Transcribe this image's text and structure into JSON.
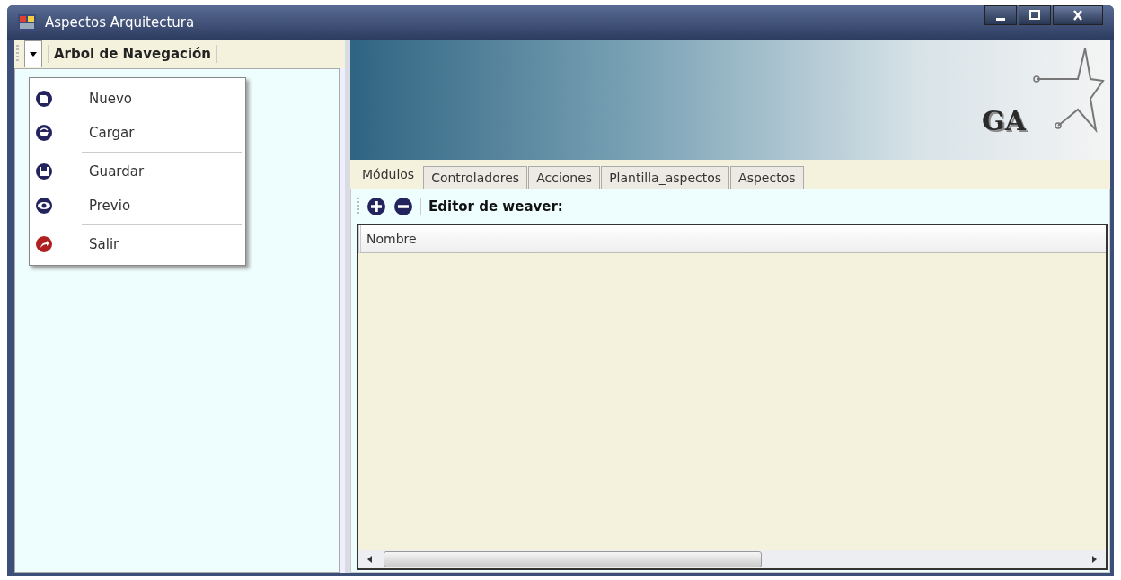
{
  "window": {
    "title": "Aspectos Arquitectura"
  },
  "nav_toolbar": {
    "title": "Arbol de Navegación",
    "menu_expanded": true
  },
  "menu": [
    {
      "label": "Nuevo",
      "kind": "new",
      "separator_before": false
    },
    {
      "label": "Cargar",
      "kind": "load",
      "separator_before": false
    },
    {
      "label": "Guardar",
      "kind": "save",
      "separator_before": true
    },
    {
      "label": "Previo",
      "kind": "preview",
      "separator_before": false
    },
    {
      "label": "Salir",
      "kind": "exit",
      "separator_before": true
    }
  ],
  "banner": {
    "logo": "GA"
  },
  "tabs": [
    {
      "label": "Módulos",
      "selected": true
    },
    {
      "label": "Controladores",
      "selected": false
    },
    {
      "label": "Acciones",
      "selected": false
    },
    {
      "label": "Plantilla_aspectos",
      "selected": false
    },
    {
      "label": "Aspectos",
      "selected": false
    }
  ],
  "toolbar": {
    "title": "Editor de weaver:"
  },
  "table": {
    "columns": [
      "Nombre"
    ]
  }
}
